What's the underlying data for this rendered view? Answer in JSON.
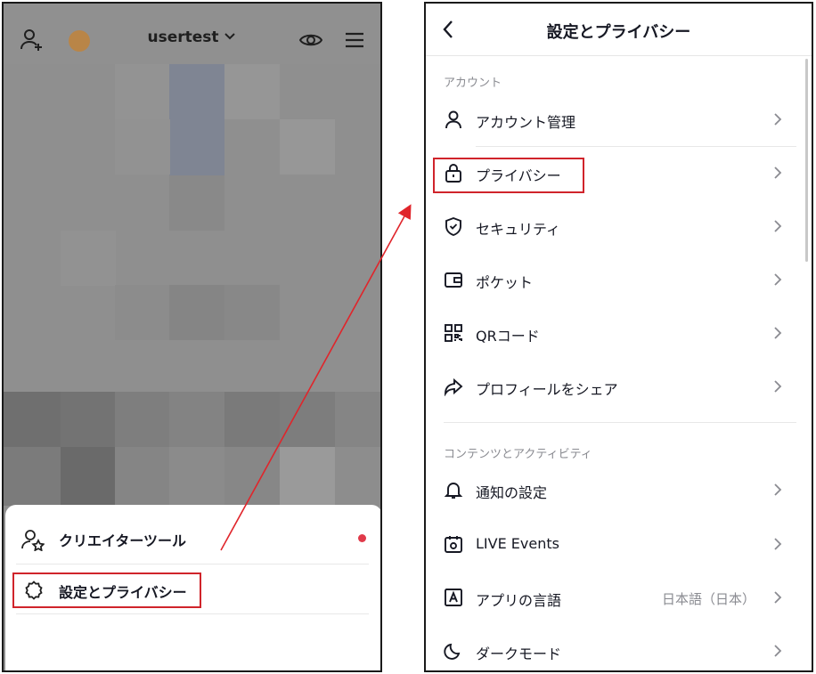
{
  "left_phone": {
    "username": "usertest",
    "icons": [
      "add-user-icon",
      "avatar",
      "chevron-down-icon",
      "eye-icon",
      "menu-icon"
    ],
    "sheet_items": [
      {
        "label": "クリエイターツール",
        "icon": "creator-tools-icon",
        "has_dot": true
      },
      {
        "label": "設定とプライバシー",
        "icon": "gear-icon",
        "has_dot": false
      }
    ]
  },
  "right_phone": {
    "header": {
      "title": "設定とプライバシー",
      "back_icon": "back-icon"
    },
    "sections": [
      {
        "title": "アカウント",
        "items": [
          {
            "label": "アカウント管理",
            "icon": "person-icon"
          },
          {
            "label": "プライバシー",
            "icon": "lock-icon"
          },
          {
            "label": "セキュリティ",
            "icon": "shield-icon"
          },
          {
            "label": "ポケット",
            "icon": "wallet-icon"
          },
          {
            "label": "QRコード",
            "icon": "qr-code-icon"
          },
          {
            "label": "プロフィールをシェア",
            "icon": "share-icon"
          }
        ]
      },
      {
        "title": "コンテンツとアクティビティ",
        "items": [
          {
            "label": "通知の設定",
            "icon": "bell-icon"
          },
          {
            "label": "LIVE Events",
            "icon": "calendar-icon"
          },
          {
            "label": "アプリの言語",
            "icon": "language-icon",
            "value": "日本語（日本）"
          },
          {
            "label": "ダークモード",
            "icon": "moon-icon"
          }
        ]
      }
    ]
  },
  "colors": {
    "highlight": "#d0242b",
    "arrow": "#e0252b",
    "overlay": "#8f8f8f",
    "dot": "#e03a4a"
  }
}
